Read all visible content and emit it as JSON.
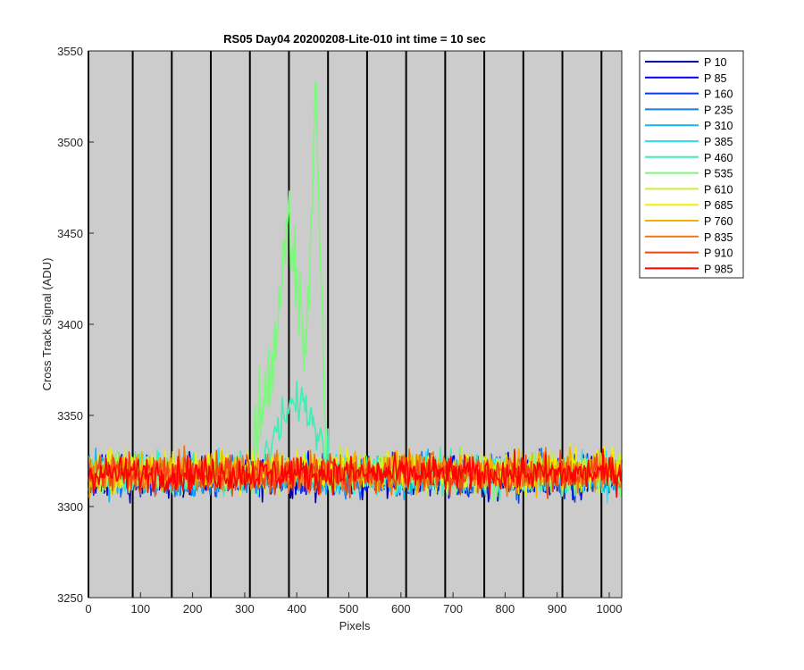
{
  "chart_data": {
    "type": "line",
    "title": "RS05 Day04 20200208-Lite-010 int time = 10 sec",
    "xlabel": "Pixels",
    "ylabel": "Cross Track Signal (ADU)",
    "xlim": [
      0,
      1024
    ],
    "ylim": [
      3250,
      3550
    ],
    "xticks": [
      0,
      100,
      200,
      300,
      400,
      500,
      600,
      700,
      800,
      900,
      1000
    ],
    "yticks": [
      3250,
      3300,
      3350,
      3400,
      3450,
      3500,
      3550
    ],
    "xtick_labels": [
      "0",
      "100",
      "200",
      "300",
      "400",
      "500",
      "600",
      "700",
      "800",
      "900",
      "1000"
    ],
    "ytick_labels": [
      "3250",
      "3300",
      "3350",
      "3400",
      "3450",
      "3500",
      "3550"
    ],
    "background_color": "#cccccc",
    "vertical_dividers_x": [
      0,
      85,
      160,
      235,
      310,
      385,
      460,
      535,
      610,
      685,
      760,
      835,
      910,
      985
    ],
    "legend_position": "outside-right-top",
    "baseline_level": 3318,
    "series": [
      {
        "name": "P 10",
        "color": "#0000b0",
        "mean": 3316,
        "noise": 9
      },
      {
        "name": "P 85",
        "color": "#0000e6",
        "mean": 3317,
        "noise": 9
      },
      {
        "name": "P 160",
        "color": "#0a3ce6",
        "mean": 3316,
        "noise": 9
      },
      {
        "name": "P 235",
        "color": "#1e78e6",
        "mean": 3317,
        "noise": 9
      },
      {
        "name": "P 310",
        "color": "#14b4f0",
        "mean": 3317,
        "noise": 9
      },
      {
        "name": "P 385",
        "color": "#28e6f0",
        "mean": 3318,
        "noise": 9
      },
      {
        "name": "P 460",
        "color": "#3cf0b4",
        "mean": 3318,
        "noise": 9,
        "peak": {
          "x_range": [
            340,
            460
          ],
          "max": 3362
        }
      },
      {
        "name": "P 535",
        "color": "#7cf87c",
        "mean": 3318,
        "noise": 9,
        "peak": {
          "x_range": [
            320,
            455
          ],
          "points": [
            [
              330,
              3350
            ],
            [
              365,
              3400
            ],
            [
              385,
              3462
            ],
            [
              415,
              3385
            ],
            [
              437,
              3516
            ],
            [
              455,
              3345
            ]
          ]
        }
      },
      {
        "name": "P 610",
        "color": "#c8f03c",
        "mean": 3319,
        "noise": 9
      },
      {
        "name": "P 685",
        "color": "#f0f000",
        "mean": 3320,
        "noise": 9
      },
      {
        "name": "P 760",
        "color": "#f0b400",
        "mean": 3319,
        "noise": 9
      },
      {
        "name": "P 835",
        "color": "#f07814",
        "mean": 3319,
        "noise": 9
      },
      {
        "name": "P 910",
        "color": "#f04614",
        "mean": 3318,
        "noise": 9
      },
      {
        "name": "P 985",
        "color": "#ff0000",
        "mean": 3318,
        "noise": 8
      }
    ]
  }
}
